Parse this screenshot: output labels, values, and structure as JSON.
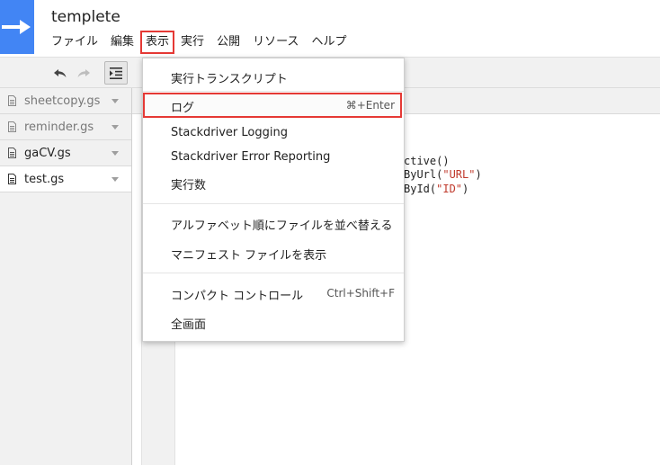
{
  "header": {
    "title": "templete",
    "menu": [
      "ファイル",
      "編集",
      "表示",
      "実行",
      "公開",
      "リソース",
      "ヘルプ"
    ]
  },
  "toolbar": {
    "undo_icon": "undo-icon",
    "redo_icon": "redo-icon",
    "indent_icon": "indent-icon"
  },
  "sidebar": {
    "files": [
      {
        "name": "sheetcopy.gs"
      },
      {
        "name": "reminder.gs"
      },
      {
        "name": "gaCV.gs"
      },
      {
        "name": "test.gs"
      }
    ]
  },
  "editor": {
    "code_lines": [
      {
        "a": "ctive()",
        "s": ""
      },
      {
        "a": "ByUrl(",
        "s": "\"URL\"",
        "b": ")"
      },
      {
        "a": "ById(",
        "s": "\"ID\"",
        "b": ")"
      }
    ]
  },
  "dropdown": {
    "items": [
      {
        "label": "実行トランスクリプト",
        "shortcut": ""
      },
      {
        "label": "ログ",
        "shortcut": "⌘+Enter"
      },
      {
        "label": "Stackdriver Logging",
        "shortcut": ""
      },
      {
        "label": "Stackdriver Error Reporting",
        "shortcut": ""
      },
      {
        "label": "実行数",
        "shortcut": ""
      },
      {
        "label": "アルファベット順にファイルを並べ替える",
        "shortcut": ""
      },
      {
        "label": "マニフェスト ファイルを表示",
        "shortcut": ""
      },
      {
        "label": "コンパクト コントロール",
        "shortcut": "Ctrl+Shift+F"
      },
      {
        "label": "全画面",
        "shortcut": ""
      }
    ]
  },
  "colors": {
    "brand": "#4285f4",
    "highlight": "#e53935"
  }
}
